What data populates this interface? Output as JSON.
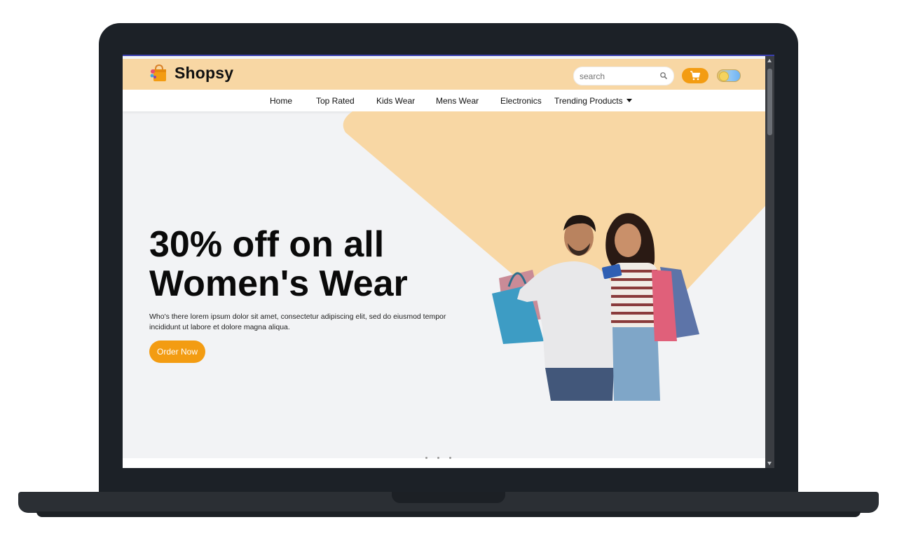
{
  "app": {
    "name": "Shopsy"
  },
  "header": {
    "search": {
      "placeholder": "search",
      "value": ""
    },
    "icons": {
      "logo": "shopping-bag-icon",
      "search": "search-icon",
      "cart": "cart-icon",
      "toggle": "theme-toggle-icon"
    }
  },
  "nav": {
    "items": [
      {
        "label": "Home"
      },
      {
        "label": "Top Rated"
      },
      {
        "label": "Kids Wear"
      },
      {
        "label": "Mens Wear"
      },
      {
        "label": "Electronics"
      },
      {
        "label": "Trending Products",
        "has_dropdown": true
      }
    ]
  },
  "hero": {
    "title": "30% off on all Women's Wear",
    "description": "Who's there lorem ipsum dolor sit amet, consectetur adipiscing elit, sed do eiusmod tempor incididunt ut labore et dolore magna aliqua.",
    "button_label": "Order Now",
    "image": "couple-with-shopping-bags"
  },
  "colors": {
    "accent": "#f39c12",
    "header_bg": "#f8d7a4",
    "hero_shape": "#f8d7a4",
    "page_bg": "#f2f3f5",
    "laptop": "#1c2127"
  }
}
